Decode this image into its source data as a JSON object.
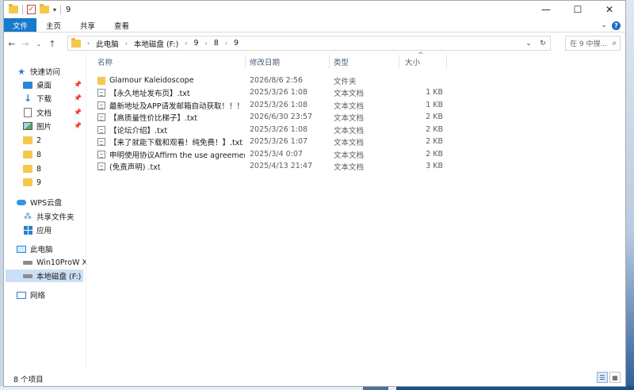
{
  "window": {
    "title": "9",
    "controls": {
      "minimize": "—",
      "maximize": "☐",
      "close": "✕"
    }
  },
  "ribbon": {
    "tabs": [
      "文件",
      "主页",
      "共享",
      "查看"
    ],
    "collapse_icon": "chevron-down-icon",
    "help": "?"
  },
  "address": {
    "crumbs": [
      "此电脑",
      "本地磁盘 (F:)",
      "9",
      "8",
      "9"
    ],
    "search_placeholder": "在 9 中搜..."
  },
  "sidebar": {
    "quick_access": "快速访问",
    "pinned": [
      {
        "label": "桌面",
        "icon": "desktop-icon"
      },
      {
        "label": "下载",
        "icon": "download-icon"
      },
      {
        "label": "文档",
        "icon": "document-icon"
      },
      {
        "label": "图片",
        "icon": "pictures-icon"
      }
    ],
    "recent_folders": [
      "2",
      "8",
      "8",
      "9"
    ],
    "wps_cloud": "WPS云盘",
    "shared_folder": "共享文件夹",
    "apps": "应用",
    "this_pc": "此电脑",
    "drives": [
      "Win10ProW X",
      "本地磁盘 (F:)"
    ],
    "network": "网络"
  },
  "columns": {
    "name": "名称",
    "date": "修改日期",
    "type": "类型",
    "size": "大小"
  },
  "files": [
    {
      "name": "Glamour Kaleidoscope",
      "date": "2026/8/6 2:56",
      "type": "文件夹",
      "size": "",
      "kind": "folder"
    },
    {
      "name": "【永久地址发布页】.txt",
      "date": "2025/3/26 1:08",
      "type": "文本文档",
      "size": "1 KB",
      "kind": "txt"
    },
    {
      "name": "最新地址及APP请发邮箱自动获取！！！....",
      "date": "2025/3/26 1:08",
      "type": "文本文档",
      "size": "1 KB",
      "kind": "txt"
    },
    {
      "name": "【高质量性价比梯子】.txt",
      "date": "2026/6/30 23:57",
      "type": "文本文档",
      "size": "2 KB",
      "kind": "txt"
    },
    {
      "name": "【论坛介绍】.txt",
      "date": "2025/3/26 1:08",
      "type": "文本文档",
      "size": "2 KB",
      "kind": "txt"
    },
    {
      "name": "【来了就能下载和观看！纯免费！】.txt",
      "date": "2025/3/26 1:07",
      "type": "文本文档",
      "size": "2 KB",
      "kind": "txt"
    },
    {
      "name": "申明使用协议Affirm the use agreemen...",
      "date": "2025/3/4 0:07",
      "type": "文本文档",
      "size": "2 KB",
      "kind": "txt"
    },
    {
      "name": "(免责声明) .txt",
      "date": "2025/4/13 21:47",
      "type": "文本文档",
      "size": "3 KB",
      "kind": "txt"
    }
  ],
  "status": {
    "count": "8 个项目"
  },
  "colors": {
    "accent": "#1979ca",
    "folder": "#f5c84c",
    "selected": "#cce0f5"
  }
}
